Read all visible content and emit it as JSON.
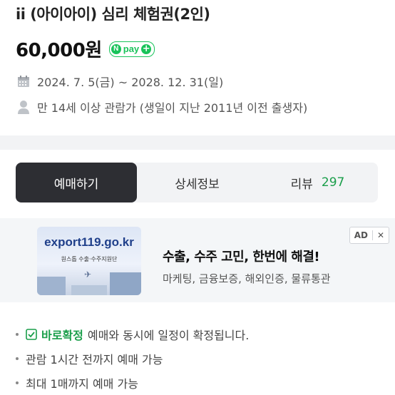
{
  "product": {
    "title": "ii (아이아이) 심리 체험권(2인)",
    "price": "60,000원",
    "npay": {
      "n": "N",
      "pay": "pay",
      "plus": "+"
    },
    "period": "2024. 7. 5(금) ~ 2028. 12. 31(일)",
    "age_limit": "만 14세 이상 관람가 (생일이 지난 2011년 이전 출생자)"
  },
  "tabs": [
    {
      "label": "예매하기",
      "active": true
    },
    {
      "label": "상세정보",
      "active": false
    },
    {
      "label": "리뷰",
      "count": "297",
      "active": false
    }
  ],
  "ad": {
    "image_url_text": "export119.go.kr",
    "image_sub_text": "원스톱 수출·수주지원단",
    "headline": "수출, 수주 고민, 한번에 해결!",
    "description": "마케팅, 금융보증, 해외인증, 물류통관",
    "badge": "AD",
    "close": "✕"
  },
  "notes": {
    "confirm_label": "바로확정",
    "confirm_text": "예매와 동시에 일정이 확정됩니다.",
    "items": [
      "관람 1시간 전까지 예매 가능",
      "최대 1매까지 예매 가능"
    ]
  },
  "colors": {
    "accent_green": "#1a9e4a",
    "npay_green": "#19c35a",
    "active_tab": "#2d2e33"
  }
}
